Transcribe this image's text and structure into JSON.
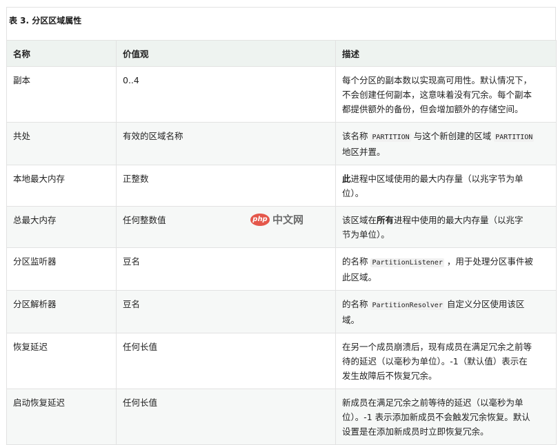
{
  "caption": "表 3. 分区区域属性",
  "headers": [
    "名称",
    "价值观",
    "描述"
  ],
  "rows": [
    {
      "name": "副本",
      "value": "0..4",
      "desc": [
        "每个分区的副本数以实现高可用性。默认情况下，",
        "不会创建任何副本，这意味着没有冗余。每个副本",
        "都提供额外的备份，但会增加额外的存储空间。"
      ]
    },
    {
      "name": "共处",
      "value": "有效的区域名称",
      "desc_a": "该名称 ",
      "code1": "PARTITION",
      "desc_b": " 与这个新创建的区域 ",
      "code2": "PARTITION",
      "desc_c": "地区并置。"
    },
    {
      "name": "本地最大内存",
      "value": "正整数",
      "bold": "此",
      "desc_rest": "进程中区域使用的最大内存量（以兆字节为单",
      "desc_line2": "位）。"
    },
    {
      "name": "总最大内存",
      "value": "任何整数值",
      "desc_a": "该区域在",
      "bold": "所有",
      "desc_b": "进程中使用的最大内存量（以兆字",
      "desc_line2": "节为单位）。"
    },
    {
      "name": "分区监听器",
      "value": "豆名",
      "desc_a": "的名称 ",
      "code": "PartitionListener",
      "desc_b": " ，用于处理分区事件被",
      "desc_line2": "此区域。"
    },
    {
      "name": "分区解析器",
      "value": "豆名",
      "desc_a": "的名称 ",
      "code": "PartitionResolver",
      "desc_b": " 自定义分区使用该区",
      "desc_line2": "域。"
    },
    {
      "name": "恢复延迟",
      "value": "任何长值",
      "desc": [
        "在另一个成员崩溃后，现有成员在满足冗余之前等",
        "待的延迟（以毫秒为单位）。-1（默认值）表示在",
        "发生故障后不恢复冗余。"
      ]
    },
    {
      "name": "启动恢复延迟",
      "value": "任何长值",
      "desc": [
        "新成员在满足冗余之前等待的延迟（以毫秒为单",
        "位）。-1 表示添加新成员不会触发冗余恢复。默认",
        "设置是在添加新成员时立即恢复冗余。"
      ]
    }
  ],
  "watermark": {
    "logo": "php",
    "text": "中文网"
  }
}
